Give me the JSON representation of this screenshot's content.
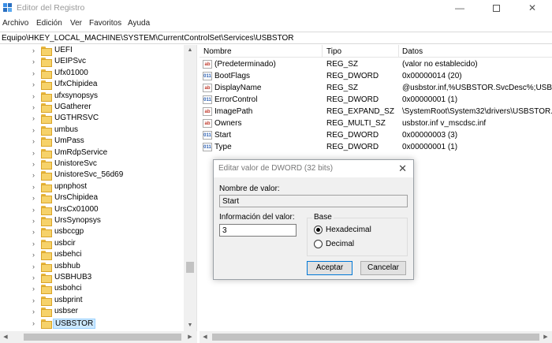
{
  "window": {
    "title": "Editor del Registro"
  },
  "menu": [
    {
      "label": "Archivo"
    },
    {
      "label": "Edición"
    },
    {
      "label": "Ver"
    },
    {
      "label": "Favoritos"
    },
    {
      "label": "Ayuda"
    }
  ],
  "address": "Equipo\\HKEY_LOCAL_MACHINE\\SYSTEM\\CurrentControlSet\\Services\\USBSTOR",
  "tree": {
    "items": [
      {
        "label": "UEFI"
      },
      {
        "label": "UEIPSvc"
      },
      {
        "label": "Ufx01000"
      },
      {
        "label": "UfxChipidea"
      },
      {
        "label": "ufxsynopsys"
      },
      {
        "label": "UGatherer"
      },
      {
        "label": "UGTHRSVC"
      },
      {
        "label": "umbus"
      },
      {
        "label": "UmPass"
      },
      {
        "label": "UmRdpService"
      },
      {
        "label": "UnistoreSvc"
      },
      {
        "label": "UnistoreSvc_56d69"
      },
      {
        "label": "upnphost"
      },
      {
        "label": "UrsChipidea"
      },
      {
        "label": "UrsCx01000"
      },
      {
        "label": "UrsSynopsys"
      },
      {
        "label": "usbccgp"
      },
      {
        "label": "usbcir"
      },
      {
        "label": "usbehci"
      },
      {
        "label": "usbhub"
      },
      {
        "label": "USBHUB3"
      },
      {
        "label": "usbohci"
      },
      {
        "label": "usbprint"
      },
      {
        "label": "usbser"
      },
      {
        "label": "USBSTOR"
      }
    ]
  },
  "list": {
    "headers": {
      "name": "Nombre",
      "type": "Tipo",
      "data": "Datos"
    },
    "rows": [
      {
        "icon": "ab",
        "name": "(Predeterminado)",
        "type": "REG_SZ",
        "data": "(valor no establecido)"
      },
      {
        "icon": "bin",
        "name": "BootFlags",
        "type": "REG_DWORD",
        "data": "0x00000014 (20)"
      },
      {
        "icon": "ab",
        "name": "DisplayName",
        "type": "REG_SZ",
        "data": "@usbstor.inf,%USBSTOR.SvcDesc%;USB Mas"
      },
      {
        "icon": "bin",
        "name": "ErrorControl",
        "type": "REG_DWORD",
        "data": "0x00000001 (1)"
      },
      {
        "icon": "ab",
        "name": "ImagePath",
        "type": "REG_EXPAND_SZ",
        "data": "\\SystemRoot\\System32\\drivers\\USBSTOR.SYS"
      },
      {
        "icon": "ab",
        "name": "Owners",
        "type": "REG_MULTI_SZ",
        "data": "usbstor.inf v_mscdsc.inf"
      },
      {
        "icon": "bin",
        "name": "Start",
        "type": "REG_DWORD",
        "data": "0x00000003 (3)"
      },
      {
        "icon": "bin",
        "name": "Type",
        "type": "REG_DWORD",
        "data": "0x00000001 (1)"
      }
    ]
  },
  "dialog": {
    "title": "Editar valor de DWORD (32 bits)",
    "name_label": "Nombre de valor:",
    "name_value": "Start",
    "data_label": "Información del valor:",
    "data_value": "3",
    "base_label": "Base",
    "hex_label": "Hexadecimal",
    "dec_label": "Decimal",
    "base_selected": "Hexadecimal",
    "ok_label": "Aceptar",
    "cancel_label": "Cancelar"
  },
  "colors": {
    "selection": "#cce8ff",
    "accent": "#0078d7",
    "folder": "#f6d26a"
  }
}
